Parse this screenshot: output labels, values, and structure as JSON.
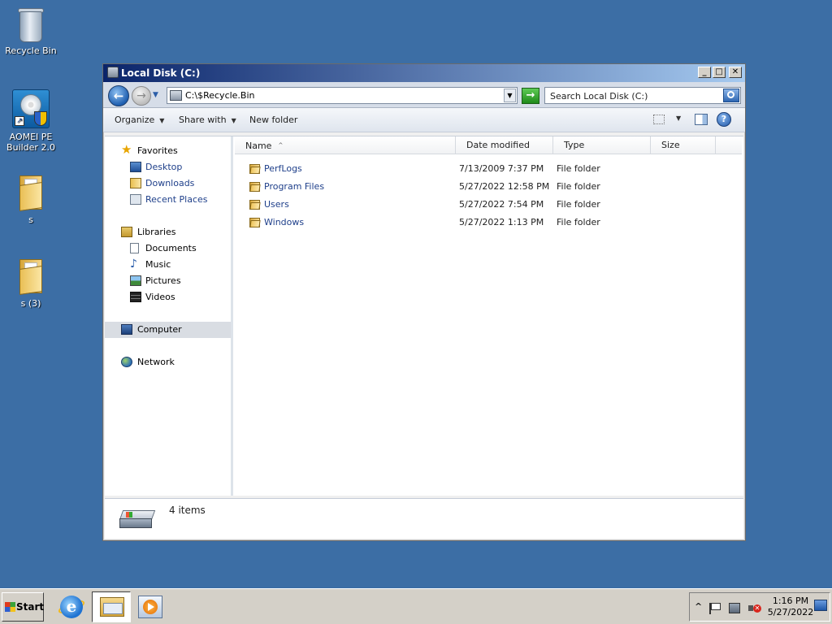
{
  "desktop": {
    "icons": [
      {
        "label": "Recycle Bin",
        "icon": "recycle-bin-icon"
      },
      {
        "label": "AOMEI PE Builder 2.0",
        "icon": "aomei-icon"
      },
      {
        "label": "s",
        "icon": "folder-icon"
      },
      {
        "label": "s (3)",
        "icon": "folder-icon"
      }
    ],
    "background_color": "#3c6ea5"
  },
  "window": {
    "title": "Local Disk (C:)",
    "controls": {
      "minimize": "_",
      "maximize": "□",
      "close": "✕"
    },
    "address": {
      "value": "C:\\$Recycle.Bin"
    },
    "search": {
      "placeholder": "Search Local Disk (C:)"
    },
    "nav_glyphs": {
      "back": "←",
      "forward": "→",
      "recent": "▼",
      "go": "→",
      "help": "?"
    },
    "toolbar": {
      "organize": "Organize",
      "share_with": "Share with",
      "new_folder": "New folder",
      "caret": "▼"
    },
    "nav_pane": {
      "favorites": {
        "label": "Favorites",
        "items": [
          "Desktop",
          "Downloads",
          "Recent Places"
        ]
      },
      "libraries": {
        "label": "Libraries",
        "items": [
          "Documents",
          "Music",
          "Pictures",
          "Videos"
        ]
      },
      "computer": "Computer",
      "network": "Network"
    },
    "columns": {
      "name": "Name",
      "date": "Date modified",
      "type": "Type",
      "size": "Size",
      "sort_glyph": "^"
    },
    "files": [
      {
        "name": "PerfLogs",
        "date": "7/13/2009 7:37 PM",
        "type": "File folder",
        "size": ""
      },
      {
        "name": "Program Files",
        "date": "5/27/2022 12:58 PM",
        "type": "File folder",
        "size": ""
      },
      {
        "name": "Users",
        "date": "5/27/2022 7:54 PM",
        "type": "File folder",
        "size": ""
      },
      {
        "name": "Windows",
        "date": "5/27/2022 1:13 PM",
        "type": "File folder",
        "size": ""
      }
    ],
    "status": {
      "item_count": "4 items"
    }
  },
  "taskbar": {
    "start_label": "Start",
    "tray_chevron": "^",
    "clock": {
      "time": "1:16 PM",
      "date": "5/27/2022"
    }
  }
}
